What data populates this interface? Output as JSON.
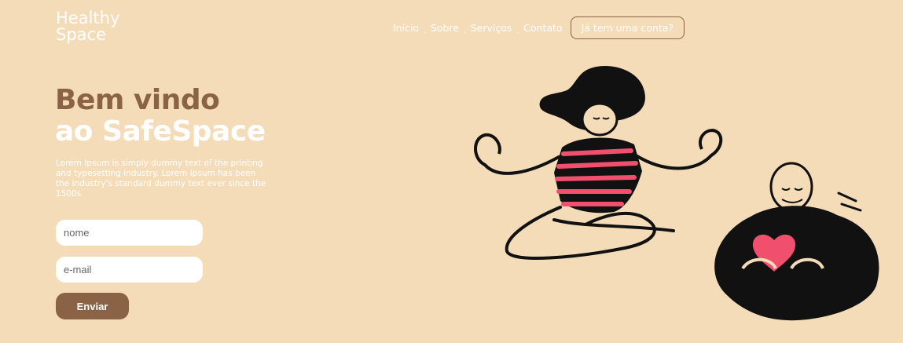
{
  "brand": {
    "line1": "Healthy",
    "line2": "Space"
  },
  "nav": {
    "items": [
      {
        "label": "Início"
      },
      {
        "label": "Sobre"
      },
      {
        "label": "Serviços"
      },
      {
        "label": "Contato"
      }
    ],
    "separator": ".",
    "account_button": "Já tem uma conta?"
  },
  "hero": {
    "title_line1": "Bem vindo",
    "title_line2": "ao SafeSpace",
    "description": "Lorem Ipsum is simply dummy text of the printing and typesetting industry. Lorem Ipsum has been the industry's standard dummy text ever since the 1500s"
  },
  "form": {
    "name_placeholder": "nome",
    "email_placeholder": "e-mail",
    "submit_label": "Enviar"
  },
  "colors": {
    "background": "#f5dcb8",
    "accent": "#8a6346",
    "text_light": "#ffffff",
    "ink": "#111111",
    "stripe_pink": "#f0506e"
  }
}
